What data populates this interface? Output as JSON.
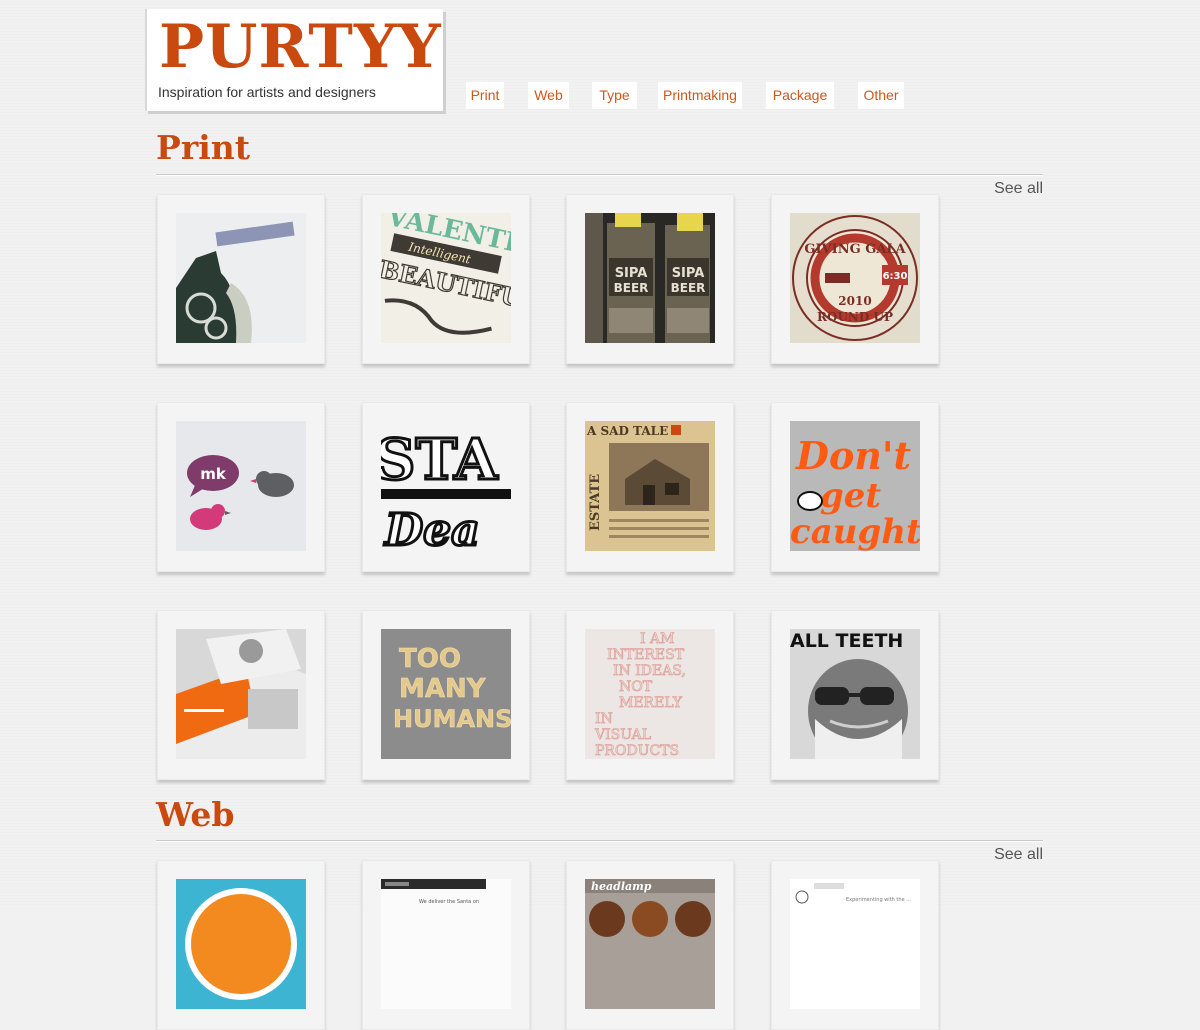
{
  "logo": {
    "title": "PURTYY",
    "tagline": "Inspiration for artists and designers"
  },
  "nav": [
    "Print",
    "Web",
    "Type",
    "Printmaking",
    "Package",
    "Other"
  ],
  "sections": [
    {
      "title": "Print",
      "see_all": "See all",
      "thumbs": [
        {
          "name": "thumb-print-ribbon-bottle"
        },
        {
          "name": "thumb-print-valentine-type",
          "text": [
            "VALENTI",
            "Intelligent",
            "BEAUTIFUL"
          ]
        },
        {
          "name": "thumb-print-sipa-beer",
          "text": [
            "SIPA",
            "BEER"
          ]
        },
        {
          "name": "thumb-print-giving-gala",
          "text": [
            "GIVING GALA",
            "2010",
            "ROUND UP"
          ]
        },
        {
          "name": "thumb-print-mk-birds",
          "text": [
            "mk"
          ]
        },
        {
          "name": "thumb-print-sta-lettering",
          "text": [
            "STA",
            "Dea"
          ]
        },
        {
          "name": "thumb-print-sad-tale",
          "text": [
            "A SAD TALE",
            "ESTATE"
          ]
        },
        {
          "name": "thumb-print-dont-get-caught",
          "text": [
            "Don't",
            "get",
            "caught"
          ]
        },
        {
          "name": "thumb-print-orange-cards"
        },
        {
          "name": "thumb-print-too-many-humans",
          "text": [
            "TOO",
            "MANY",
            "HUMANS"
          ]
        },
        {
          "name": "thumb-print-interest-ideas",
          "text": [
            "I AM",
            "INTEREST",
            "IN IDEAS,",
            "NOT",
            "MERELY",
            "IN",
            "VISUAL",
            "PRODUCTS"
          ]
        },
        {
          "name": "thumb-print-all-teeth",
          "text": [
            "ALL TEETH"
          ]
        }
      ]
    },
    {
      "title": "Web",
      "see_all": "See all",
      "thumbs": [
        {
          "name": "thumb-web-circle"
        },
        {
          "name": "thumb-web-dark-header",
          "text": [
            "We deliver the Santa on"
          ]
        },
        {
          "name": "thumb-web-headlamp",
          "text": [
            "headlamp"
          ]
        },
        {
          "name": "thumb-web-experimenting",
          "text": [
            "Experimenting with the ..."
          ]
        }
      ]
    }
  ],
  "colors": {
    "accent": "#c9490e",
    "nav_text": "#d0561c",
    "page_bg": "#f2f1f1"
  }
}
